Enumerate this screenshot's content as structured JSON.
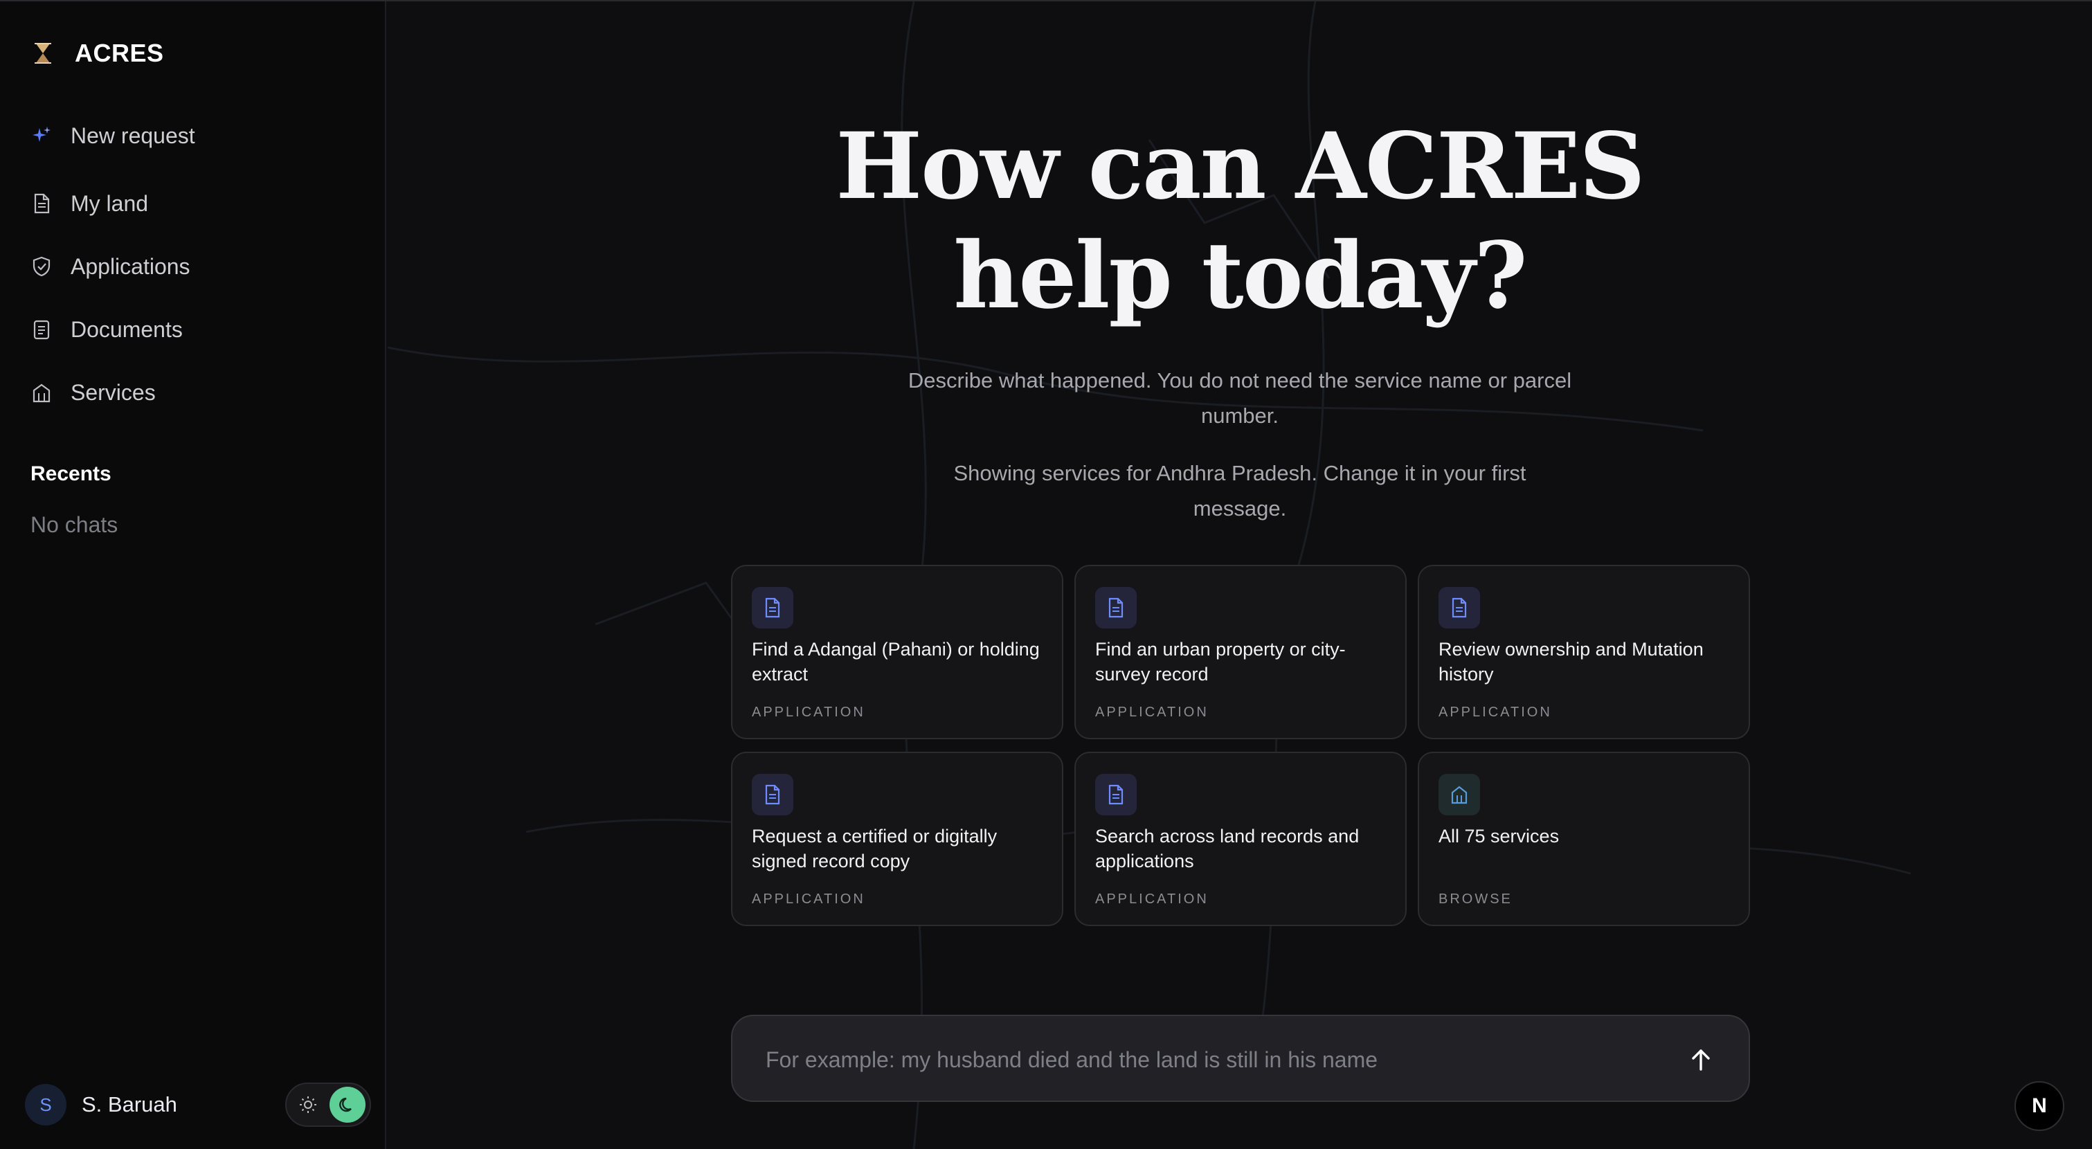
{
  "brand": {
    "name": "ACRES",
    "logo_icon": "hourglass-logo-icon"
  },
  "sidebar": {
    "items": [
      {
        "label": "New request",
        "icon": "sparkle-icon"
      },
      {
        "label": "My land",
        "icon": "document-icon"
      },
      {
        "label": "Applications",
        "icon": "shield-check-icon"
      },
      {
        "label": "Documents",
        "icon": "file-icon"
      },
      {
        "label": "Services",
        "icon": "building-icon"
      }
    ],
    "recents_title": "Recents",
    "recents_empty": "No chats"
  },
  "user": {
    "initial": "S",
    "name": "S. Baruah"
  },
  "theme": {
    "active": "dark",
    "accent": "#5fcf98"
  },
  "main": {
    "headline_line1": "How can ACRES",
    "headline_line2": "help today?",
    "subtitle": "Describe what happened. You do not need the service name or parcel number.",
    "region_note": "Showing services for Andhra Pradesh. Change it in your first message.",
    "cards": [
      {
        "title": "Find a Adangal (Pahani) or holding extract",
        "tag": "APPLICATION",
        "icon": "document-icon"
      },
      {
        "title": "Find an urban property or city-survey record",
        "tag": "APPLICATION",
        "icon": "document-icon"
      },
      {
        "title": "Review ownership and Mutation history",
        "tag": "APPLICATION",
        "icon": "document-icon"
      },
      {
        "title": "Request a certified or digitally signed record copy",
        "tag": "APPLICATION",
        "icon": "document-icon"
      },
      {
        "title": "Search across land records and applications",
        "tag": "APPLICATION",
        "icon": "document-icon"
      },
      {
        "title": "All 75 services",
        "tag": "BROWSE",
        "icon": "building-icon"
      }
    ],
    "composer": {
      "placeholder": "For example: my husband died and the land is still in his name",
      "send_icon": "arrow-up-icon"
    }
  },
  "badge": {
    "label": "N"
  }
}
